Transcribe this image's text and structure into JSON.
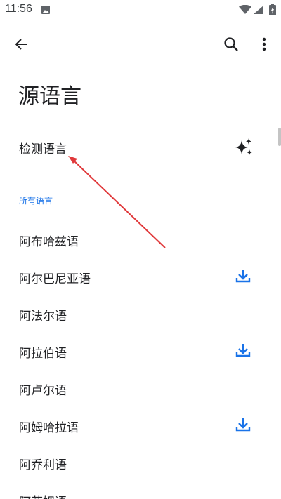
{
  "status_bar": {
    "time": "11:56"
  },
  "app_bar": {
    "back_icon": "arrow-back-icon",
    "search_icon": "search-icon",
    "more_icon": "more-vert-icon"
  },
  "title": "源语言",
  "detect_language": {
    "label": "检测语言",
    "icon": "sparkle-icon"
  },
  "section_header": "所有语言",
  "languages": [
    {
      "label": "阿布哈兹语",
      "downloadable": false
    },
    {
      "label": "阿尔巴尼亚语",
      "downloadable": true
    },
    {
      "label": "阿法尔语",
      "downloadable": false
    },
    {
      "label": "阿拉伯语",
      "downloadable": true
    },
    {
      "label": "阿卢尔语",
      "downloadable": false
    },
    {
      "label": "阿姆哈拉语",
      "downloadable": true
    },
    {
      "label": "阿乔利语",
      "downloadable": false
    },
    {
      "label": "阿菲姆语",
      "downloadable": false
    }
  ],
  "colors": {
    "accent": "#1a73e8",
    "annotation_arrow": "#e0393b",
    "text": "#202124"
  }
}
